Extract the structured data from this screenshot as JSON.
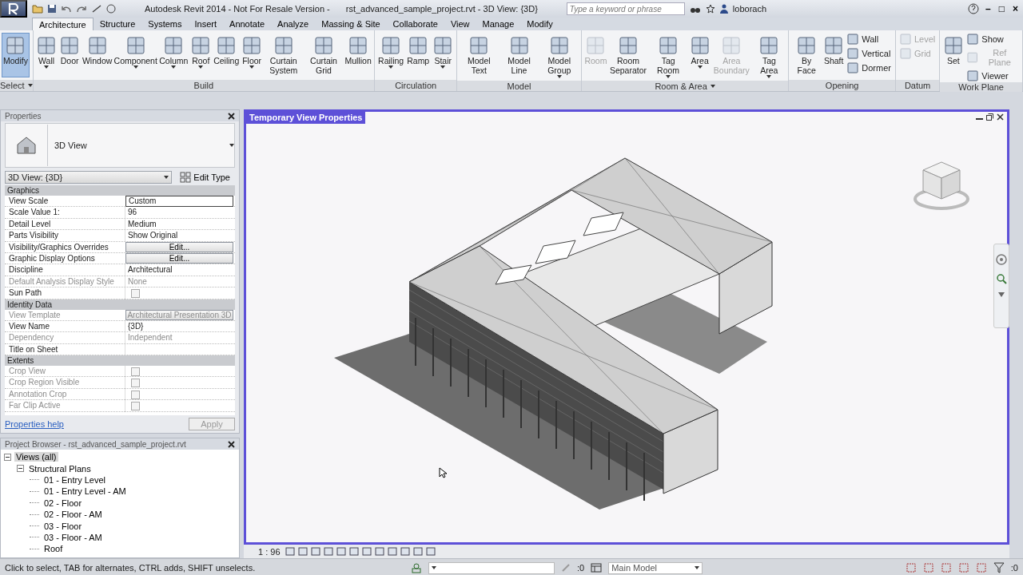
{
  "title_bar": {
    "app_title": "Autodesk Revit 2014 - Not For Resale Version -",
    "document_title": "rst_advanced_sample_project.rvt - 3D View: {3D}",
    "search": {
      "placeholder": "Type a keyword or phrase"
    },
    "user": "loborach",
    "window_controls": [
      "–",
      "□",
      "×"
    ]
  },
  "tabs": [
    {
      "label": "Architecture",
      "selected": true
    },
    {
      "label": "Structure",
      "selected": false
    },
    {
      "label": "Systems",
      "selected": false
    },
    {
      "label": "Insert",
      "selected": false
    },
    {
      "label": "Annotate",
      "selected": false
    },
    {
      "label": "Analyze",
      "selected": false
    },
    {
      "label": "Massing & Site",
      "selected": false
    },
    {
      "label": "Collaborate",
      "selected": false
    },
    {
      "label": "View",
      "selected": false
    },
    {
      "label": "Manage",
      "selected": false
    },
    {
      "label": "Modify",
      "selected": false
    }
  ],
  "ribbon": [
    {
      "name": "Select",
      "menu": true,
      "tools": [
        {
          "label": "Modify",
          "kind": "large",
          "selected": true,
          "disabled": false
        }
      ]
    },
    {
      "name": "Build",
      "menu": false,
      "tools": [
        {
          "label": "Wall",
          "kind": "large",
          "dropdown": true,
          "selected": false,
          "disabled": false
        },
        {
          "label": "Door",
          "kind": "large",
          "selected": false,
          "disabled": false
        },
        {
          "label": "Window",
          "kind": "large",
          "selected": false,
          "disabled": false
        },
        {
          "label": "Component",
          "kind": "large",
          "dropdown": true,
          "selected": false,
          "disabled": false
        },
        {
          "label": "Column",
          "kind": "large",
          "dropdown": true,
          "selected": false,
          "disabled": false
        },
        {
          "label": "Roof",
          "kind": "large",
          "dropdown": true,
          "selected": false,
          "disabled": false
        },
        {
          "label": "Ceiling",
          "kind": "large",
          "selected": false,
          "disabled": false
        },
        {
          "label": "Floor",
          "kind": "large",
          "dropdown": true,
          "selected": false,
          "disabled": false
        },
        {
          "label": "Curtain System",
          "kind": "large",
          "selected": false,
          "disabled": false
        },
        {
          "label": "Curtain Grid",
          "kind": "large",
          "selected": false,
          "disabled": false
        },
        {
          "label": "Mullion",
          "kind": "large",
          "selected": false,
          "disabled": false
        }
      ]
    },
    {
      "name": "Circulation",
      "menu": false,
      "tools": [
        {
          "label": "Railing",
          "kind": "large",
          "dropdown": true,
          "selected": false,
          "disabled": false
        },
        {
          "label": "Ramp",
          "kind": "large",
          "selected": false,
          "disabled": false
        },
        {
          "label": "Stair",
          "kind": "large",
          "dropdown": true,
          "selected": false,
          "disabled": false
        }
      ]
    },
    {
      "name": "Model",
      "menu": false,
      "tools": [
        {
          "label": "Model Text",
          "kind": "large",
          "selected": false,
          "disabled": false
        },
        {
          "label": "Model Line",
          "kind": "large",
          "selected": false,
          "disabled": false
        },
        {
          "label": "Model Group",
          "kind": "large",
          "dropdown": true,
          "selected": false,
          "disabled": false
        }
      ]
    },
    {
      "name": "Room & Area",
      "menu": true,
      "tools": [
        {
          "label": "Room",
          "kind": "large",
          "selected": false,
          "disabled": true
        },
        {
          "label": "Room Separator",
          "kind": "large",
          "selected": false,
          "disabled": false
        },
        {
          "label": "Tag Room",
          "kind": "large",
          "dropdown": true,
          "selected": false,
          "disabled": false
        },
        {
          "label": "Area",
          "kind": "large",
          "dropdown": true,
          "selected": false,
          "disabled": false
        },
        {
          "label": "Area Boundary",
          "kind": "large",
          "selected": false,
          "disabled": true
        },
        {
          "label": "Tag Area",
          "kind": "large",
          "dropdown": true,
          "selected": false,
          "disabled": false
        }
      ]
    },
    {
      "name": "Opening",
      "menu": false,
      "tools": [
        {
          "label": "By Face",
          "kind": "large",
          "selected": false,
          "disabled": false
        },
        {
          "label": "Shaft",
          "kind": "large",
          "selected": false,
          "disabled": false
        },
        {
          "label": "Wall",
          "kind": "small",
          "selected": false,
          "disabled": false
        },
        {
          "label": "Vertical",
          "kind": "small",
          "selected": false,
          "disabled": false
        },
        {
          "label": "Dormer",
          "kind": "small",
          "selected": false,
          "disabled": false
        }
      ]
    },
    {
      "name": "Datum",
      "menu": false,
      "tools": [
        {
          "label": "Level",
          "kind": "small",
          "selected": false,
          "disabled": true
        },
        {
          "label": "Grid",
          "kind": "small",
          "selected": false,
          "disabled": true
        }
      ]
    },
    {
      "name": "Work Plane",
      "menu": false,
      "tools": [
        {
          "label": "Set",
          "kind": "large",
          "selected": false,
          "disabled": false
        },
        {
          "label": "Show",
          "kind": "small",
          "selected": false,
          "disabled": false
        },
        {
          "label": "Ref Plane",
          "kind": "small",
          "selected": false,
          "disabled": true
        },
        {
          "label": "Viewer",
          "kind": "small",
          "selected": false,
          "disabled": false
        }
      ]
    }
  ],
  "properties": {
    "title": "Properties",
    "type_name": "3D View",
    "instance": "3D View: {3D}",
    "edit_type": "Edit Type",
    "groups": [
      {
        "name": "Graphics",
        "rows": [
          {
            "label": "View Scale",
            "value": "Custom",
            "kind": "field",
            "disabled": false
          },
          {
            "label": "Scale Value    1:",
            "value": "96",
            "kind": "text",
            "disabled": false
          },
          {
            "label": "Detail Level",
            "value": "Medium",
            "kind": "text",
            "disabled": false
          },
          {
            "label": "Parts Visibility",
            "value": "Show Original",
            "kind": "text",
            "disabled": false
          },
          {
            "label": "Visibility/Graphics Overrides",
            "value": "Edit...",
            "kind": "button",
            "disabled": false
          },
          {
            "label": "Graphic Display Options",
            "value": "Edit...",
            "kind": "button",
            "disabled": false
          },
          {
            "label": "Discipline",
            "value": "Architectural",
            "kind": "text",
            "disabled": false
          },
          {
            "label": "Default Analysis Display Style",
            "value": "None",
            "kind": "text",
            "disabled": true
          },
          {
            "label": "Sun Path",
            "kind": "checkbox",
            "checked": false,
            "disabled": false
          }
        ]
      },
      {
        "name": "Identity Data",
        "rows": [
          {
            "label": "View Template",
            "value": "Architectural Presentation 3D",
            "kind": "button",
            "disabled": true
          },
          {
            "label": "View Name",
            "value": "{3D}",
            "kind": "text",
            "disabled": false
          },
          {
            "label": "Dependency",
            "value": "Independent",
            "kind": "text",
            "disabled": true
          },
          {
            "label": "Title on Sheet",
            "kind": "text",
            "disabled": false
          }
        ]
      },
      {
        "name": "Extents",
        "rows": [
          {
            "label": "Crop View",
            "kind": "checkbox",
            "checked": false,
            "disabled": true
          },
          {
            "label": "Crop Region Visible",
            "kind": "checkbox",
            "checked": false,
            "disabled": true
          },
          {
            "label": "Annotation Crop",
            "kind": "checkbox",
            "checked": false,
            "disabled": true
          },
          {
            "label": "Far Clip Active",
            "kind": "checkbox",
            "checked": false,
            "disabled": true
          }
        ]
      }
    ],
    "help_link": "Properties help",
    "apply": {
      "label": "Apply",
      "disabled": true
    }
  },
  "project_browser": {
    "title": "Project Browser - rst_advanced_sample_project.rvt",
    "tree": [
      {
        "label": "Views (all)",
        "expanded": true,
        "selected": true,
        "children": [
          {
            "label": "Structural Plans",
            "expanded": true,
            "selected": false,
            "children": [
              {
                "label": "01 - Entry Level",
                "selected": false
              },
              {
                "label": "01 - Entry Level - AM",
                "selected": false
              },
              {
                "label": "02 - Floor",
                "selected": false
              },
              {
                "label": "02 - Floor - AM",
                "selected": false
              },
              {
                "label": "03 - Floor",
                "selected": false
              },
              {
                "label": "03 - Floor - AM",
                "selected": false
              },
              {
                "label": "Roof",
                "selected": false
              }
            ]
          }
        ]
      }
    ]
  },
  "view": {
    "title": "Temporary View Properties",
    "scale": "1 : 96"
  },
  "status_bar": {
    "message": "Click to select, TAB for alternates, CTRL adds, SHIFT unselects.",
    "editable_count": ":0",
    "workset": "Main Model",
    "filter_count": ":0"
  }
}
